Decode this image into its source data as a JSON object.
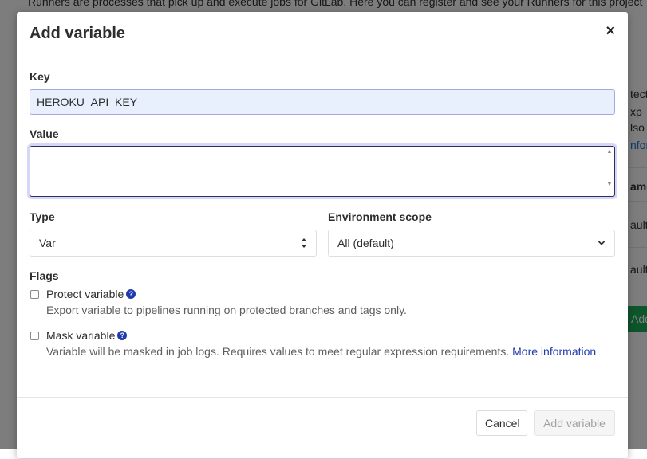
{
  "background": {
    "top_text": "Runners are processes that pick up and execute jobs for GitLab. Here you can register and see your Runners for this project",
    "right_fragments": [
      "tect",
      "xp",
      "lso a",
      "nform",
      "ame",
      "ault",
      "ault"
    ],
    "add_button": "Add"
  },
  "modal": {
    "title": "Add variable",
    "close_label": "×",
    "key": {
      "label": "Key",
      "value": "HEROKU_API_KEY"
    },
    "value_field": {
      "label": "Value",
      "value": ""
    },
    "type": {
      "label": "Type",
      "selected": "Var"
    },
    "environment_scope": {
      "label": "Environment scope",
      "selected": "All (default)"
    },
    "flags": {
      "label": "Flags",
      "protect": {
        "label": "Protect variable",
        "checked": false,
        "help": "Export variable to pipelines running on protected branches and tags only."
      },
      "mask": {
        "label": "Mask variable",
        "checked": false,
        "help": "Variable will be masked in job logs. Requires values to meet regular expression requirements.",
        "link": "More information"
      }
    },
    "footer": {
      "cancel_label": "Cancel",
      "add_label": "Add variable"
    }
  },
  "colors": {
    "link": "#1f3bb0",
    "overlay": "rgba(0,0,0,0.5)",
    "primary_green": "#1aaa55"
  }
}
